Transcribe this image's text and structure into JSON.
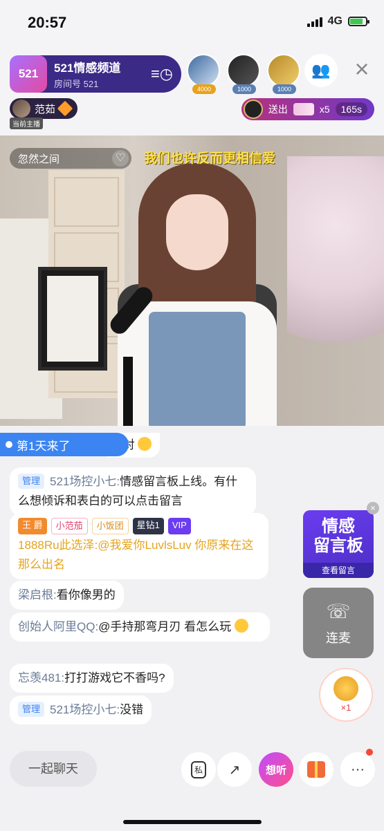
{
  "status": {
    "time": "20:57",
    "network": "4G"
  },
  "room": {
    "title": "521情感频道",
    "id_label": "房间号 521",
    "logo_text": "521"
  },
  "viewers": [
    {
      "count": "4000"
    },
    {
      "count": "1000"
    },
    {
      "count": "1000"
    }
  ],
  "host": {
    "name": "范茹",
    "tag": "当前主播"
  },
  "gift_banner": {
    "sent_label": "送出",
    "qty": "x5",
    "timer": "165s"
  },
  "song": {
    "title": "忽然之间"
  },
  "lyric": "我们也许反而更相信爱",
  "welcome": "第1天来了",
  "chat": [
    {
      "text": "快 对"
    },
    {
      "badge": "管理",
      "nick": "521场控小七:",
      "text": "情感留言板上线。有什么想倾诉和表白的可以点击留言"
    },
    {
      "badges": [
        "王 爵",
        "小范茄",
        "小饭团",
        "星钻1",
        "VIP"
      ],
      "nick": "1888Ru此选泽:",
      "text": "@我爱你LuvlsLuv 你原来在这那么出名"
    },
    {
      "nick": "梁启根:",
      "text": "看你像男的"
    },
    {
      "nick": "创始人阿里QQ:",
      "text": "@手持那弯月刃 看怎么玩"
    },
    {
      "nick": "忘羡481:",
      "text": "打打游戏它不香吗?"
    },
    {
      "badge": "管理",
      "nick": "521场控小七:",
      "text": "没错"
    }
  ],
  "promo": {
    "title_line1": "情感",
    "title_line2": "留言板",
    "cta": "查看留言"
  },
  "call": {
    "label": "连麦"
  },
  "float_gift": {
    "count": "×1"
  },
  "bottom": {
    "chat_placeholder": "一起聊天",
    "private_label": "私",
    "listen_label": "想听"
  },
  "colors": {
    "accent": "#3b84f1",
    "room_pill": "#3b2a86",
    "lyric": "#ffe14a"
  }
}
